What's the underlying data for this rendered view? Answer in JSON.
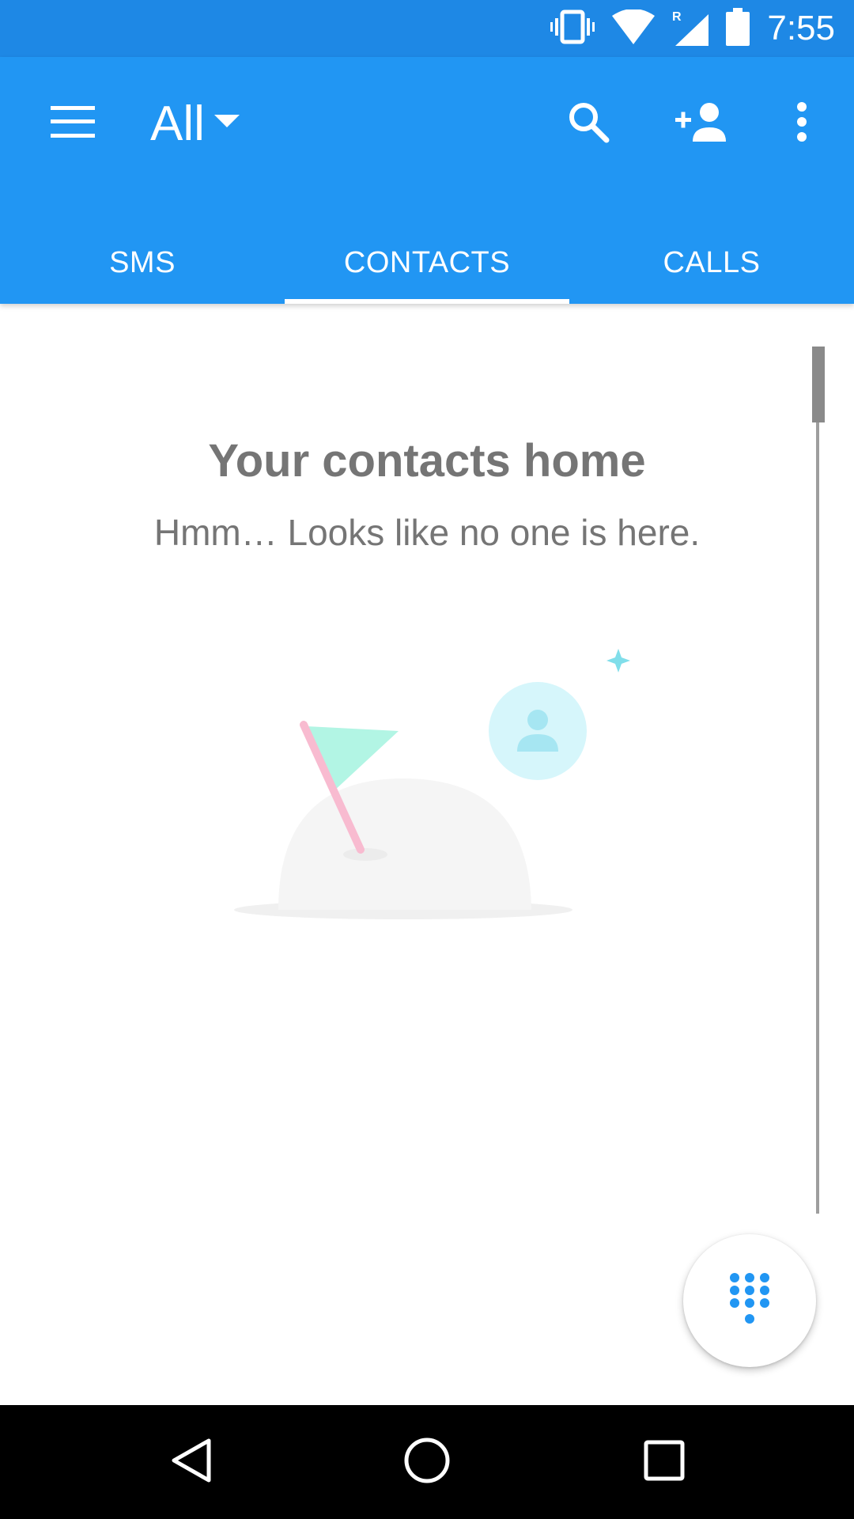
{
  "status_bar": {
    "time": "7:55",
    "icons": [
      "vibrate-icon",
      "wifi-icon",
      "signal-roaming-icon",
      "battery-icon"
    ]
  },
  "toolbar": {
    "menu_icon": "hamburger-menu-icon",
    "filter_label": "All",
    "filter_icon": "dropdown-arrow-icon",
    "actions": [
      "search-icon",
      "add-contact-icon",
      "more-vert-icon"
    ]
  },
  "tabs": [
    {
      "label": "SMS",
      "selected": false
    },
    {
      "label": "CONTACTS",
      "selected": true
    },
    {
      "label": "CALLS",
      "selected": false
    }
  ],
  "empty_state": {
    "title": "Your contacts home",
    "subtitle": "Hmm… Looks like no one is here."
  },
  "fab": {
    "icon": "dialpad-icon"
  },
  "nav_bar": {
    "icons": [
      "back-icon",
      "home-icon",
      "recents-icon"
    ]
  },
  "colors": {
    "status_bar": "#1e88e5",
    "app_bar": "#2196f3",
    "accent": "#2196f3",
    "text_secondary": "#757575",
    "illustration_flag": "#b2f5e4",
    "illustration_pole": "#f8bbd0",
    "illustration_avatar": "#d6f6fb"
  }
}
